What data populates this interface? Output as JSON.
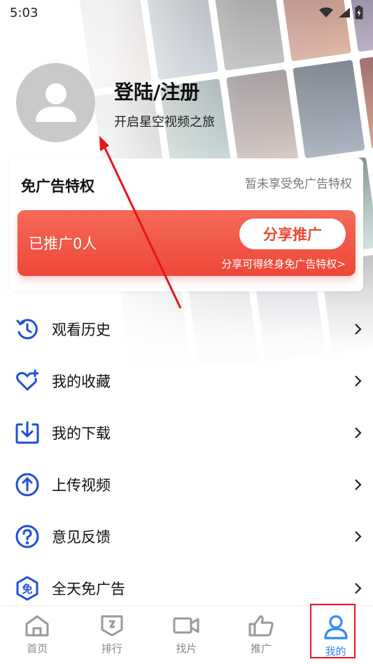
{
  "status_bar": {
    "time": "5:03"
  },
  "profile": {
    "login_title": "登陆/注册",
    "subtitle": "开启星空视频之旅"
  },
  "adfree": {
    "title": "免广告特权",
    "status": "暂未享受免广告特权",
    "promo_count": "已推广0人",
    "share_button": "分享推广",
    "hint": "分享可得终身免广告特权>",
    "accent_color": "#ee4738"
  },
  "menu": {
    "items": [
      {
        "label": "观看历史",
        "icon": "history-icon"
      },
      {
        "label": "我的收藏",
        "icon": "heart-plus-icon"
      },
      {
        "label": "我的下载",
        "icon": "download-icon"
      },
      {
        "label": "上传视频",
        "icon": "upload-icon"
      },
      {
        "label": "意见反馈",
        "icon": "question-icon"
      },
      {
        "label": "全天免广告",
        "icon": "adfree-badge-icon",
        "badge": "免"
      }
    ],
    "icon_color": "#1d4fd8"
  },
  "nav": {
    "items": [
      {
        "label": "首页",
        "icon": "home-icon"
      },
      {
        "label": "排行",
        "icon": "ranking-icon"
      },
      {
        "label": "找片",
        "icon": "video-camera-icon"
      },
      {
        "label": "推广",
        "icon": "thumbs-up-icon"
      },
      {
        "label": "我的",
        "icon": "user-icon",
        "active": true
      }
    ],
    "active_color": "#2f8bf5"
  }
}
